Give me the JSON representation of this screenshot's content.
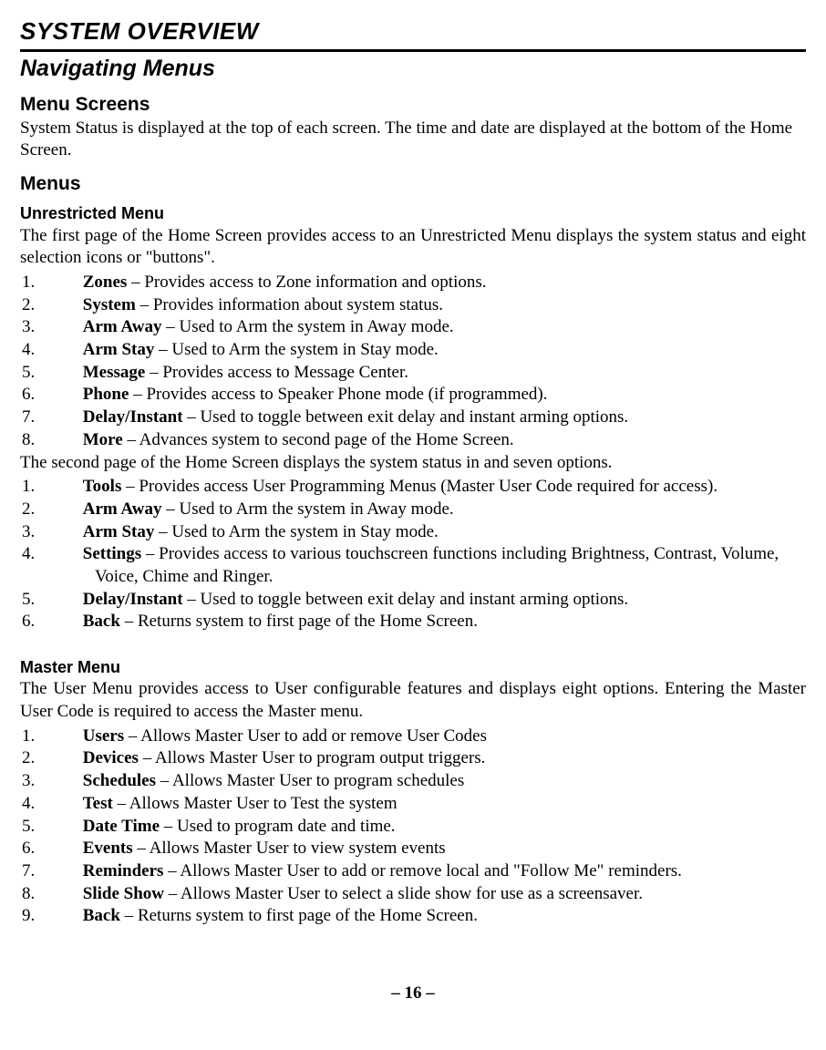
{
  "chapterTitle": "SYSTEM OVERVIEW",
  "sectionTitle": "Navigating Menus",
  "menuScreens": {
    "title": "Menu Screens",
    "text": "System Status is displayed at the top of each screen. The time and date are displayed at the bottom of the Home Screen."
  },
  "menus": {
    "title": "Menus",
    "unrestricted": {
      "title": "Unrestricted Menu",
      "intro": "The first page of the Home Screen provides access to an Unrestricted Menu displays the system status and eight selection icons or \"buttons\".",
      "list1": [
        {
          "term": "Zones",
          "desc": " – Provides access to Zone information and options."
        },
        {
          "term": "System",
          "desc": " –  Provides information about system status."
        },
        {
          "term": "Arm Away",
          "desc": " – Used to Arm the system in Away mode."
        },
        {
          "term": "Arm Stay",
          "desc": " – Used to Arm the system in Stay mode."
        },
        {
          "term": "Message",
          "desc": " –  Provides access to Message Center."
        },
        {
          "term": "Phone",
          "desc": " – Provides access to Speaker Phone mode (if programmed)."
        },
        {
          "term": "Delay/Instant",
          "desc": " – Used to toggle between exit delay and instant arming options."
        },
        {
          "term": "More",
          "desc": " – Advances system to second page of the Home Screen."
        }
      ],
      "mid": "The second page of the Home Screen displays the system status in and seven options.",
      "list2": [
        {
          "term": "Tools",
          "desc": " – Provides access User Programming Menus (Master User Code required for access)."
        },
        {
          "term": "Arm Away",
          "desc": " – Used to Arm the system in Away mode."
        },
        {
          "term": "Arm Stay",
          "desc": " – Used to Arm the system in Stay mode."
        },
        {
          "term": "Settings",
          "desc": " – Provides access to various touchscreen functions including Brightness, Contrast, Volume, Voice, Chime and Ringer."
        },
        {
          "term": "Delay/Instant",
          "desc": " – Used to toggle between exit delay and instant arming options."
        },
        {
          "term": "Back",
          "desc": " – Returns system to first page of the Home Screen."
        }
      ]
    },
    "master": {
      "title": "Master Menu",
      "intro": "The User Menu provides access to User configurable features and displays eight options. Entering the Master User Code is required to access the Master menu.",
      "list": [
        {
          "term": "Users",
          "desc": " – Allows Master User to add or remove User Codes"
        },
        {
          "term": "Devices",
          "desc": " – Allows Master User to program output triggers."
        },
        {
          "term": "Schedules",
          "desc": " – Allows Master User to program schedules"
        },
        {
          "term": "Test",
          "desc": " – Allows Master User to Test the system"
        },
        {
          "term": "Date Time",
          "desc": " – Used to program date and time."
        },
        {
          "term": "Events",
          "desc": " – Allows Master User to view system events"
        },
        {
          "term": "Reminders",
          "desc": " – Allows Master User to add or remove local and \"Follow Me\" reminders."
        },
        {
          "term": "Slide Show",
          "desc": " – Allows Master User to select a slide show for use as a screensaver."
        },
        {
          "term": "Back",
          "desc": " – Returns system to first page of the Home Screen."
        }
      ]
    }
  },
  "pageNumber": "– 16 –"
}
